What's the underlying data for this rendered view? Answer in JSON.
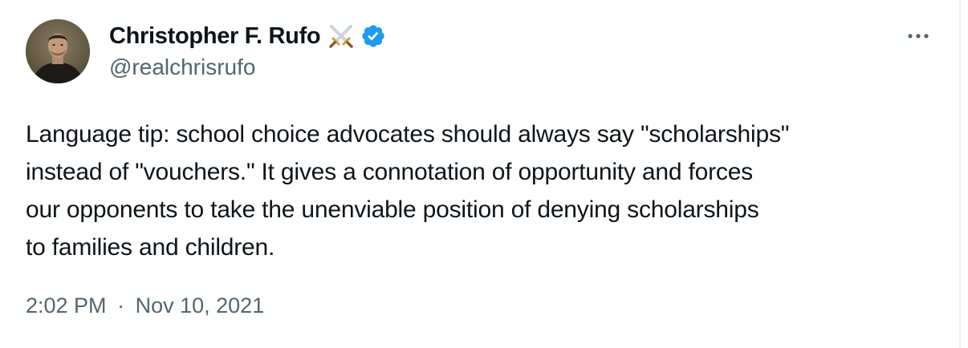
{
  "author": {
    "display_name": "Christopher F. Rufo",
    "handle": "@realchrisrufo",
    "name_emoji": "crossed-swords-icon",
    "verified_badge": "verified-badge-icon",
    "verified_color": "#1d9bf0"
  },
  "tweet": {
    "text": "Language tip: school choice advocates should always say \"scholarships\"\ninstead of \"vouchers.\" It gives a connotation of opportunity and forces\nour opponents to take the unenviable position of denying scholarships\nto families and children.",
    "time": "2:02 PM",
    "separator": "·",
    "date": "Nov 10, 2021"
  },
  "menu": {
    "more_icon": "more-dots-icon"
  },
  "colors": {
    "text_primary": "#0f1419",
    "text_secondary": "#536471",
    "border": "#eff3f4"
  }
}
